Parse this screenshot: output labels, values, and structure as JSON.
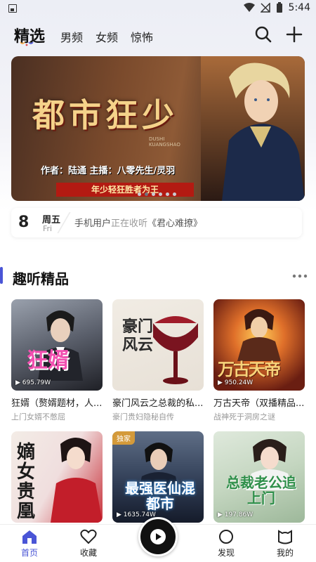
{
  "status_bar": {
    "time": "5:44"
  },
  "top_nav": {
    "tabs": [
      {
        "label": "精选",
        "active": true
      },
      {
        "label": "男频",
        "active": false
      },
      {
        "label": "女频",
        "active": false
      },
      {
        "label": "惊怖",
        "active": false
      }
    ],
    "icons": [
      "search-icon",
      "plus-icon"
    ]
  },
  "banner": {
    "title": "都市狂少",
    "pinyin_line1": "DUSHI",
    "pinyin_line2": "KUANGSHAO",
    "credits": "作者：陆通  主播：八零先生/灵羽",
    "slogan": "年少轻狂胜者为王",
    "dots": 6,
    "active_dot": 0
  },
  "ticker": {
    "day": "8",
    "weekday": "周五",
    "weekday_en": "Fri",
    "text_user": "手机用户",
    "text_action": "正在收听",
    "text_book": "《君心难撩》"
  },
  "section": {
    "title": "趣听精品",
    "more_icon": "more-dots-icon",
    "accent": "#4a55d6"
  },
  "books": [
    {
      "title": "狂婿（赘婿题材，人...",
      "desc": "上门女婿不憋屈",
      "plays": "695.79W",
      "badge": "",
      "cover_text": "狂婿"
    },
    {
      "title": "豪门风云之总裁的私...",
      "desc": "豪门贵妇隐秘自传",
      "plays": "",
      "badge": "",
      "cover_text": "豪门风云"
    },
    {
      "title": "万古天帝（双播精品...",
      "desc": "战神死于洞房之谜",
      "plays": "950.24W",
      "badge": "",
      "cover_text": "万古天帝"
    },
    {
      "title": "",
      "desc": "",
      "plays": "",
      "badge": "",
      "cover_text": "嫡女贵凰"
    },
    {
      "title": "",
      "desc": "",
      "plays": "1635.74W",
      "badge": "独家",
      "cover_text": "最强医仙混都市"
    },
    {
      "title": "",
      "desc": "",
      "plays": "197.86W",
      "badge": "",
      "cover_text": "总裁老公追上门"
    }
  ],
  "bottom_nav": [
    {
      "label": "首页",
      "icon": "home-icon",
      "active": true
    },
    {
      "label": "收藏",
      "icon": "heart-icon",
      "active": false
    },
    {
      "label": "发现",
      "icon": "discover-icon",
      "active": false
    },
    {
      "label": "我的",
      "icon": "profile-icon",
      "active": false
    }
  ],
  "player": {
    "icon": "play-icon"
  }
}
